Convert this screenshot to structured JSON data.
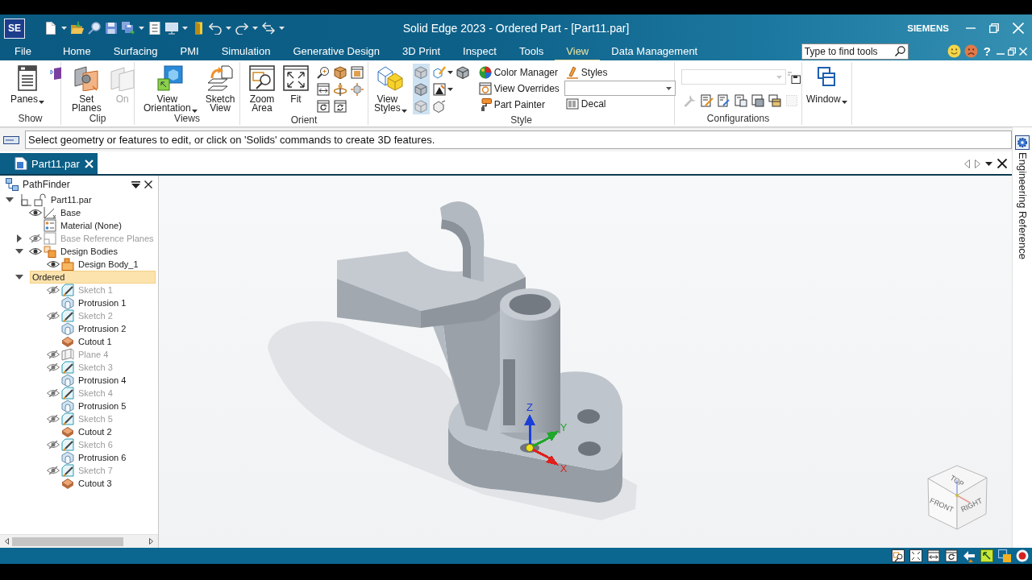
{
  "title_bar": {
    "logo": "SE",
    "title": "Solid Edge 2023 - Ordered Part - [Part11.par]",
    "brand": "SIEMENS"
  },
  "menu_bar": {
    "tabs": [
      {
        "label": "File",
        "selected": false
      },
      {
        "label": "Home",
        "selected": false
      },
      {
        "label": "Surfacing",
        "selected": false
      },
      {
        "label": "PMI",
        "selected": false
      },
      {
        "label": "Simulation",
        "selected": false
      },
      {
        "label": "Generative Design",
        "selected": false
      },
      {
        "label": "3D Print",
        "selected": false
      },
      {
        "label": "Inspect",
        "selected": false
      },
      {
        "label": "Tools",
        "selected": false
      },
      {
        "label": "View",
        "selected": true
      },
      {
        "label": "Data Management",
        "selected": false
      }
    ],
    "search": {
      "placeholder": "Type to find tools"
    },
    "help": "?"
  },
  "ribbon": {
    "groups": [
      {
        "kind": "show",
        "label": "Show",
        "buttons": [
          {
            "label": "Panes",
            "menu": true,
            "disabled": false
          }
        ]
      },
      {
        "kind": "clip",
        "label": "Clip",
        "buttons": [
          {
            "label": "Set Planes",
            "menu": false,
            "disabled": false
          },
          {
            "label": "On",
            "menu": false,
            "disabled": true
          }
        ]
      },
      {
        "kind": "views",
        "label": "Views",
        "buttons": [
          {
            "label": "View Orientation",
            "menu": true,
            "disabled": false
          },
          {
            "label": "Sketch View",
            "menu": false,
            "disabled": false
          }
        ]
      },
      {
        "kind": "orient",
        "label": "Orient",
        "buttons": [
          {
            "label": "Zoom Area",
            "menu": false,
            "disabled": false
          },
          {
            "label": "Fit",
            "menu": false,
            "disabled": false
          }
        ]
      },
      {
        "kind": "style",
        "label": "Style",
        "buttons": [
          {
            "label": "View Styles",
            "menu": true,
            "disabled": false
          }
        ],
        "display_modes": [
          {
            "selected": true
          },
          {
            "selected": true
          },
          {
            "selected": true
          }
        ],
        "command_columns": [
          [
            {
              "label": "Color Manager"
            },
            {
              "label": "View Overrides"
            },
            {
              "label": "Part Painter"
            }
          ],
          [
            {
              "label": "Styles"
            },
            {
              "label": "Decal"
            }
          ]
        ]
      },
      {
        "kind": "configurations",
        "label": "Configurations",
        "dropdown": {
          "disabled": true
        },
        "tools": [
          {
            "disabled": true
          },
          {
            "disabled": false
          },
          {
            "disabled": false
          },
          {
            "disabled": false
          },
          {
            "disabled": false
          },
          {
            "disabled": false
          },
          {
            "disabled": true
          }
        ]
      },
      {
        "kind": "window",
        "buttons": [
          {
            "label": "Window",
            "menu": true,
            "disabled": false
          }
        ]
      }
    ]
  },
  "command_bar": {
    "prompt": "Select geometry or features to edit, or click on 'Solids' commands to create 3D features."
  },
  "document_tabs": [
    {
      "label": "Part11.par",
      "selected": true
    }
  ],
  "pathfinder": {
    "title": "PathFinder",
    "tree": [
      {
        "label": "Part11.par",
        "kind": "part",
        "expanded": true,
        "dimmed": false,
        "selected": false,
        "children": [
          {
            "label": "Base",
            "kind": "base",
            "visible": true,
            "dimmed": false,
            "selected": false
          },
          {
            "label": "Material (None)",
            "kind": "material",
            "dimmed": false,
            "selected": false
          },
          {
            "label": "Base Reference Planes",
            "kind": "planes",
            "expanded": false,
            "visible": false,
            "dimmed": true,
            "selected": false
          },
          {
            "label": "Design Bodies",
            "kind": "bodies",
            "expanded": true,
            "visible": true,
            "dimmed": false,
            "selected": false,
            "children": [
              {
                "label": "Design Body_1",
                "kind": "body",
                "visible": true,
                "dimmed": false,
                "selected": false
              }
            ]
          },
          {
            "label": "Ordered",
            "kind": "folder",
            "expanded": true,
            "dimmed": false,
            "selected": true,
            "children": [
              {
                "label": "Sketch 1",
                "kind": "sketch",
                "visible": false,
                "dimmed": true,
                "selected": false
              },
              {
                "label": "Protrusion 1",
                "kind": "protrusion",
                "dimmed": false,
                "selected": false
              },
              {
                "label": "Sketch 2",
                "kind": "sketch",
                "visible": false,
                "dimmed": true,
                "selected": false
              },
              {
                "label": "Protrusion 2",
                "kind": "protrusion",
                "dimmed": false,
                "selected": false
              },
              {
                "label": "Cutout 1",
                "kind": "cutout",
                "dimmed": false,
                "selected": false
              },
              {
                "label": "Plane 4",
                "kind": "plane",
                "visible": false,
                "dimmed": true,
                "selected": false
              },
              {
                "label": "Sketch 3",
                "kind": "sketch",
                "visible": false,
                "dimmed": true,
                "selected": false
              },
              {
                "label": "Protrusion 4",
                "kind": "protrusion",
                "dimmed": false,
                "selected": false
              },
              {
                "label": "Sketch 4",
                "kind": "sketch",
                "visible": false,
                "dimmed": true,
                "selected": false
              },
              {
                "label": "Protrusion 5",
                "kind": "protrusion",
                "dimmed": false,
                "selected": false
              },
              {
                "label": "Sketch 5",
                "kind": "sketch",
                "visible": false,
                "dimmed": true,
                "selected": false
              },
              {
                "label": "Cutout 2",
                "kind": "cutout",
                "dimmed": false,
                "selected": false
              },
              {
                "label": "Sketch 6",
                "kind": "sketch",
                "visible": false,
                "dimmed": true,
                "selected": false
              },
              {
                "label": "Protrusion 6",
                "kind": "protrusion",
                "dimmed": false,
                "selected": false
              },
              {
                "label": "Sketch 7",
                "kind": "sketch",
                "visible": false,
                "dimmed": true,
                "selected": false
              },
              {
                "label": "Cutout 3",
                "kind": "cutout",
                "dimmed": false,
                "selected": false
              }
            ]
          }
        ]
      }
    ]
  },
  "viewport": {
    "triad": [
      {
        "label": "Z",
        "color": "#1a3fd8"
      },
      {
        "label": "Y",
        "color": "#1fa82a"
      },
      {
        "label": "X",
        "color": "#e0201c"
      }
    ],
    "view_cube": {
      "faces": [
        "TOP",
        "FRONT",
        "RIGHT"
      ]
    }
  },
  "side_panel": {
    "label": "Engineering Reference"
  }
}
